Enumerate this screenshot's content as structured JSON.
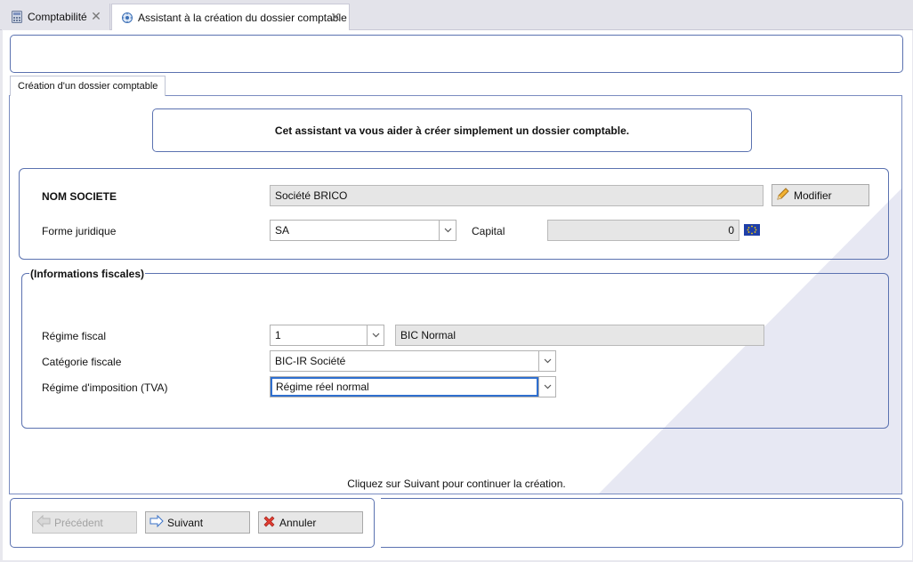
{
  "tabs": [
    {
      "label": "Comptabilité",
      "icon": "calculator-icon"
    },
    {
      "label": "Assistant à la création du dossier comptable",
      "icon": "wizard-icon"
    }
  ],
  "inner_tab": {
    "label": "Création d'un dossier comptable"
  },
  "intro": {
    "text": "Cet assistant va vous aider à créer simplement un dossier comptable."
  },
  "company": {
    "name_label": "NOM SOCIETE",
    "name_value": "Société BRICO",
    "modify_label": "Modifier",
    "forme_label": "Forme juridique",
    "forme_value": "SA",
    "capital_label": "Capital",
    "capital_value": "0",
    "currency_icon": "euro-flag-icon"
  },
  "fiscal": {
    "legend": "(Informations fiscales)",
    "regime_label": "Régime fiscal",
    "regime_code": "1",
    "regime_desc": "BIC Normal",
    "categorie_label": "Catégorie fiscale",
    "categorie_value": "BIC-IR Société",
    "tva_label": "Régime d'imposition (TVA)",
    "tva_value": "Régime réel normal"
  },
  "hint": "Cliquez sur Suivant pour continuer la création.",
  "footer": {
    "previous_label": "Précédent",
    "next_label": "Suivant",
    "cancel_label": "Annuler"
  },
  "colors": {
    "panel_border": "#5b72b0",
    "focus_border": "#2f6fcf",
    "field_bg": "#e6e6e6"
  }
}
